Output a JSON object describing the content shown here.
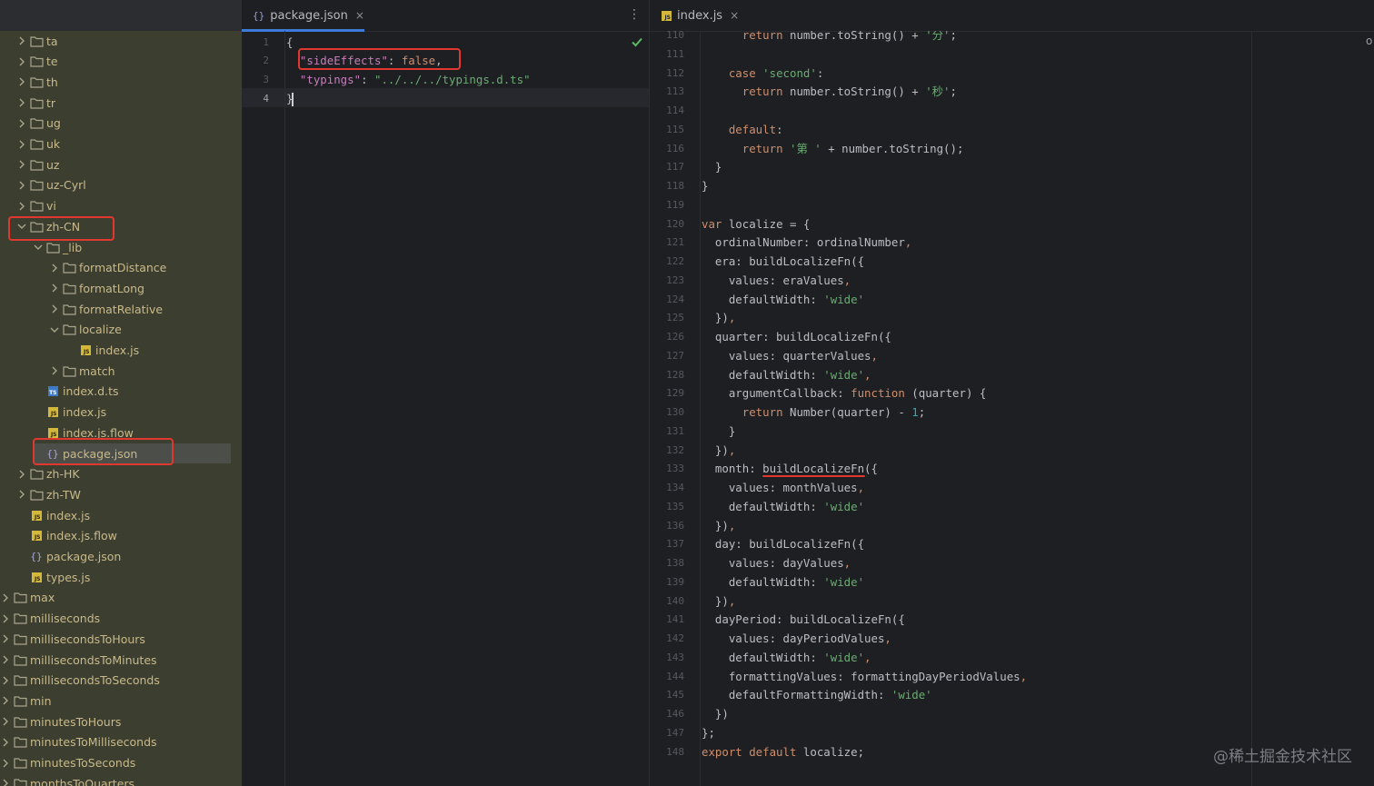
{
  "tree": {
    "rows": [
      {
        "label": "ta",
        "kind": "folder",
        "depth": 1,
        "expanded": false
      },
      {
        "label": "te",
        "kind": "folder",
        "depth": 1,
        "expanded": false
      },
      {
        "label": "th",
        "kind": "folder",
        "depth": 1,
        "expanded": false
      },
      {
        "label": "tr",
        "kind": "folder",
        "depth": 1,
        "expanded": false
      },
      {
        "label": "ug",
        "kind": "folder",
        "depth": 1,
        "expanded": false
      },
      {
        "label": "uk",
        "kind": "folder",
        "depth": 1,
        "expanded": false
      },
      {
        "label": "uz",
        "kind": "folder",
        "depth": 1,
        "expanded": false
      },
      {
        "label": "uz-Cyrl",
        "kind": "folder",
        "depth": 1,
        "expanded": false
      },
      {
        "label": "vi",
        "kind": "folder",
        "depth": 1,
        "expanded": false
      },
      {
        "label": "zh-CN",
        "kind": "folder",
        "depth": 1,
        "expanded": true
      },
      {
        "label": "_lib",
        "kind": "folder",
        "depth": 2,
        "expanded": true
      },
      {
        "label": "formatDistance",
        "kind": "folder",
        "depth": 3,
        "expanded": false
      },
      {
        "label": "formatLong",
        "kind": "folder",
        "depth": 3,
        "expanded": false
      },
      {
        "label": "formatRelative",
        "kind": "folder",
        "depth": 3,
        "expanded": false
      },
      {
        "label": "localize",
        "kind": "folder",
        "depth": 3,
        "expanded": true
      },
      {
        "label": "index.js",
        "kind": "js",
        "depth": 4
      },
      {
        "label": "match",
        "kind": "folder",
        "depth": 3,
        "expanded": false
      },
      {
        "label": "index.d.ts",
        "kind": "ts",
        "depth": 2
      },
      {
        "label": "index.js",
        "kind": "js",
        "depth": 2
      },
      {
        "label": "index.js.flow",
        "kind": "js",
        "depth": 2
      },
      {
        "label": "package.json",
        "kind": "json",
        "depth": 2,
        "selected": true
      },
      {
        "label": "zh-HK",
        "kind": "folder",
        "depth": 1,
        "expanded": false
      },
      {
        "label": "zh-TW",
        "kind": "folder",
        "depth": 1,
        "expanded": false
      },
      {
        "label": "index.js",
        "kind": "js",
        "depth": 1
      },
      {
        "label": "index.js.flow",
        "kind": "js",
        "depth": 1
      },
      {
        "label": "package.json",
        "kind": "json",
        "depth": 1
      },
      {
        "label": "types.js",
        "kind": "js",
        "depth": 1
      },
      {
        "label": "max",
        "kind": "folder",
        "depth": 0,
        "expanded": false
      },
      {
        "label": "milliseconds",
        "kind": "folder",
        "depth": 0,
        "expanded": false
      },
      {
        "label": "millisecondsToHours",
        "kind": "folder",
        "depth": 0,
        "expanded": false
      },
      {
        "label": "millisecondsToMinutes",
        "kind": "folder",
        "depth": 0,
        "expanded": false
      },
      {
        "label": "millisecondsToSeconds",
        "kind": "folder",
        "depth": 0,
        "expanded": false
      },
      {
        "label": "min",
        "kind": "folder",
        "depth": 0,
        "expanded": false
      },
      {
        "label": "minutesToHours",
        "kind": "folder",
        "depth": 0,
        "expanded": false
      },
      {
        "label": "minutesToMilliseconds",
        "kind": "folder",
        "depth": 0,
        "expanded": false
      },
      {
        "label": "minutesToSeconds",
        "kind": "folder",
        "depth": 0,
        "expanded": false
      },
      {
        "label": "monthsToQuarters",
        "kind": "folder",
        "depth": 0,
        "expanded": false
      }
    ]
  },
  "pane1": {
    "tab": {
      "icon": "{}",
      "label": "package.json",
      "close": "×"
    },
    "more": "⋮",
    "lines": [
      {
        "num": "1",
        "tokens": [
          [
            "p",
            "{"
          ]
        ]
      },
      {
        "num": "2",
        "tokens": [
          [
            "p",
            "  "
          ],
          [
            "jk",
            "\"sideEffects\""
          ],
          [
            "p",
            ": "
          ],
          [
            "k",
            "false"
          ],
          [
            "p",
            ","
          ]
        ]
      },
      {
        "num": "3",
        "tokens": [
          [
            "p",
            "  "
          ],
          [
            "jk",
            "\"typings\""
          ],
          [
            "p",
            ": "
          ],
          [
            "s",
            "\"../../../typings.d.ts\""
          ]
        ]
      },
      {
        "num": "4",
        "tokens": [
          [
            "p",
            "}"
          ]
        ]
      }
    ]
  },
  "pane2": {
    "tab": {
      "icon": "JS",
      "label": "index.js",
      "close": "×"
    },
    "corner": "o",
    "lines": [
      {
        "num": "110",
        "tokens": [
          [
            "p",
            "      "
          ],
          [
            "k",
            "return"
          ],
          [
            "p",
            " number.toString() + "
          ],
          [
            "s",
            "'分'"
          ],
          [
            "p",
            ";"
          ]
        ]
      },
      {
        "num": "111",
        "tokens": []
      },
      {
        "num": "112",
        "tokens": [
          [
            "p",
            "    "
          ],
          [
            "k",
            "case"
          ],
          [
            "p",
            " "
          ],
          [
            "s",
            "'second'"
          ],
          [
            "p",
            ":"
          ]
        ]
      },
      {
        "num": "113",
        "tokens": [
          [
            "p",
            "      "
          ],
          [
            "k",
            "return"
          ],
          [
            "p",
            " number.toString() + "
          ],
          [
            "s",
            "'秒'"
          ],
          [
            "p",
            ";"
          ]
        ]
      },
      {
        "num": "114",
        "tokens": []
      },
      {
        "num": "115",
        "tokens": [
          [
            "p",
            "    "
          ],
          [
            "k",
            "default"
          ],
          [
            "p",
            ":"
          ]
        ]
      },
      {
        "num": "116",
        "tokens": [
          [
            "p",
            "      "
          ],
          [
            "k",
            "return"
          ],
          [
            "p",
            " "
          ],
          [
            "s",
            "'第 '"
          ],
          [
            "p",
            " + number.toString();"
          ]
        ]
      },
      {
        "num": "117",
        "tokens": [
          [
            "p",
            "  }"
          ]
        ]
      },
      {
        "num": "118",
        "tokens": [
          [
            "p",
            "}"
          ]
        ]
      },
      {
        "num": "119",
        "tokens": []
      },
      {
        "num": "120",
        "tokens": [
          [
            "k",
            "var"
          ],
          [
            "p",
            " localize = {"
          ]
        ]
      },
      {
        "num": "121",
        "tokens": [
          [
            "p",
            "  ordinalNumber: ordinalNumber"
          ],
          [
            "k",
            ","
          ]
        ]
      },
      {
        "num": "122",
        "tokens": [
          [
            "p",
            "  era: buildLocalizeFn({"
          ]
        ]
      },
      {
        "num": "123",
        "tokens": [
          [
            "p",
            "    values: eraValues"
          ],
          [
            "k",
            ","
          ]
        ]
      },
      {
        "num": "124",
        "tokens": [
          [
            "p",
            "    defaultWidth: "
          ],
          [
            "s",
            "'wide'"
          ]
        ]
      },
      {
        "num": "125",
        "tokens": [
          [
            "p",
            "  })"
          ],
          [
            "k",
            ","
          ]
        ]
      },
      {
        "num": "126",
        "tokens": [
          [
            "p",
            "  quarter: buildLocalizeFn({"
          ]
        ]
      },
      {
        "num": "127",
        "tokens": [
          [
            "p",
            "    values: quarterValues"
          ],
          [
            "k",
            ","
          ]
        ]
      },
      {
        "num": "128",
        "tokens": [
          [
            "p",
            "    defaultWidth: "
          ],
          [
            "s",
            "'wide'"
          ],
          [
            "k",
            ","
          ]
        ]
      },
      {
        "num": "129",
        "tokens": [
          [
            "p",
            "    argumentCallback: "
          ],
          [
            "k",
            "function"
          ],
          [
            "p",
            " (quarter) {"
          ]
        ]
      },
      {
        "num": "130",
        "tokens": [
          [
            "p",
            "      "
          ],
          [
            "k",
            "return"
          ],
          [
            "p",
            " Number(quarter) - "
          ],
          [
            "n",
            "1"
          ],
          [
            "p",
            ";"
          ]
        ]
      },
      {
        "num": "131",
        "tokens": [
          [
            "p",
            "    }"
          ]
        ]
      },
      {
        "num": "132",
        "tokens": [
          [
            "p",
            "  })"
          ],
          [
            "k",
            ","
          ]
        ]
      },
      {
        "num": "133",
        "tokens": [
          [
            "p",
            "  month: buildLocalizeFn({"
          ]
        ]
      },
      {
        "num": "134",
        "tokens": [
          [
            "p",
            "    values: monthValues"
          ],
          [
            "k",
            ","
          ]
        ]
      },
      {
        "num": "135",
        "tokens": [
          [
            "p",
            "    defaultWidth: "
          ],
          [
            "s",
            "'wide'"
          ]
        ]
      },
      {
        "num": "136",
        "tokens": [
          [
            "p",
            "  })"
          ],
          [
            "k",
            ","
          ]
        ]
      },
      {
        "num": "137",
        "tokens": [
          [
            "p",
            "  day: buildLocalizeFn({"
          ]
        ]
      },
      {
        "num": "138",
        "tokens": [
          [
            "p",
            "    values: dayValues"
          ],
          [
            "k",
            ","
          ]
        ]
      },
      {
        "num": "139",
        "tokens": [
          [
            "p",
            "    defaultWidth: "
          ],
          [
            "s",
            "'wide'"
          ]
        ]
      },
      {
        "num": "140",
        "tokens": [
          [
            "p",
            "  })"
          ],
          [
            "k",
            ","
          ]
        ]
      },
      {
        "num": "141",
        "tokens": [
          [
            "p",
            "  dayPeriod: buildLocalizeFn({"
          ]
        ]
      },
      {
        "num": "142",
        "tokens": [
          [
            "p",
            "    values: dayPeriodValues"
          ],
          [
            "k",
            ","
          ]
        ]
      },
      {
        "num": "143",
        "tokens": [
          [
            "p",
            "    defaultWidth: "
          ],
          [
            "s",
            "'wide'"
          ],
          [
            "k",
            ","
          ]
        ]
      },
      {
        "num": "144",
        "tokens": [
          [
            "p",
            "    formattingValues: formattingDayPeriodValues"
          ],
          [
            "k",
            ","
          ]
        ]
      },
      {
        "num": "145",
        "tokens": [
          [
            "p",
            "    defaultFormattingWidth: "
          ],
          [
            "s",
            "'wide'"
          ]
        ]
      },
      {
        "num": "146",
        "tokens": [
          [
            "p",
            "  })"
          ]
        ]
      },
      {
        "num": "147",
        "tokens": [
          [
            "p",
            "};"
          ]
        ]
      },
      {
        "num": "148",
        "tokens": [
          [
            "k",
            "export default"
          ],
          [
            "p",
            " localize;"
          ]
        ]
      }
    ]
  },
  "watermark": "@稀土掘金技术社区",
  "colors": {
    "highlight": "#e0382e",
    "accent": "#3d7bd9"
  }
}
